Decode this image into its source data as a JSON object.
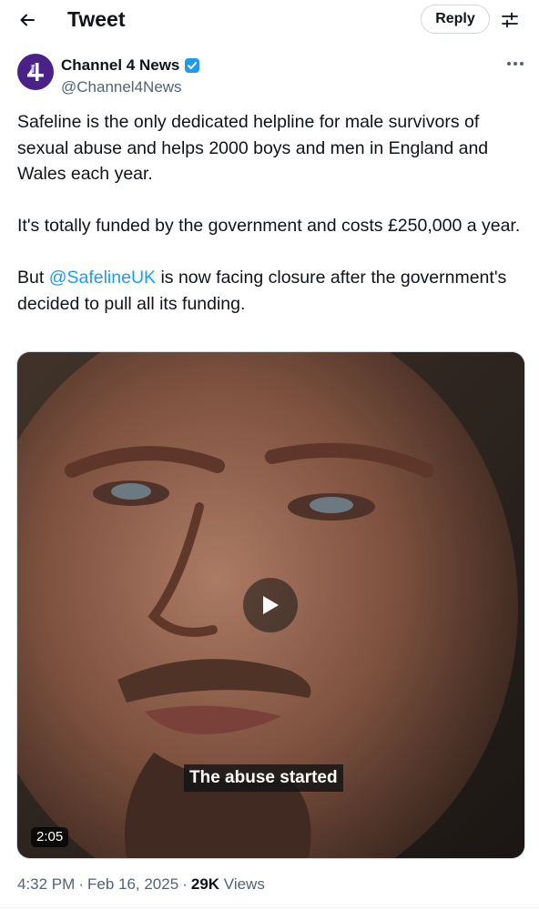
{
  "header": {
    "title": "Tweet",
    "reply_label": "Reply",
    "back_icon": "arrow-left-icon",
    "settings_icon": "sliders-icon"
  },
  "author": {
    "name": "Channel 4 News",
    "handle": "@Channel4News",
    "verified": true,
    "avatar_color": "#4a2287",
    "badge_color": "#1d9bf0"
  },
  "tweet": {
    "paragraph1": "Safeline is the only dedicated helpline for male survivors of sexual abuse and helps 2000 boys and men in England and Wales each year.",
    "paragraph2": "It's totally funded by the government and costs £250,000 a year.",
    "paragraph3_before": "But ",
    "paragraph3_mention": "@SafelineUK",
    "paragraph3_after": " is now facing closure after the government's decided to pull all its funding."
  },
  "media": {
    "type": "video",
    "caption": "The abuse started",
    "duration": "2:05"
  },
  "meta": {
    "time": "4:32 PM",
    "date": "Feb 16, 2025",
    "views_count": "29K",
    "views_label": "Views"
  },
  "colors": {
    "link": "#1d9bf0",
    "secondary_text": "#536471",
    "primary_text": "#0f1419"
  }
}
